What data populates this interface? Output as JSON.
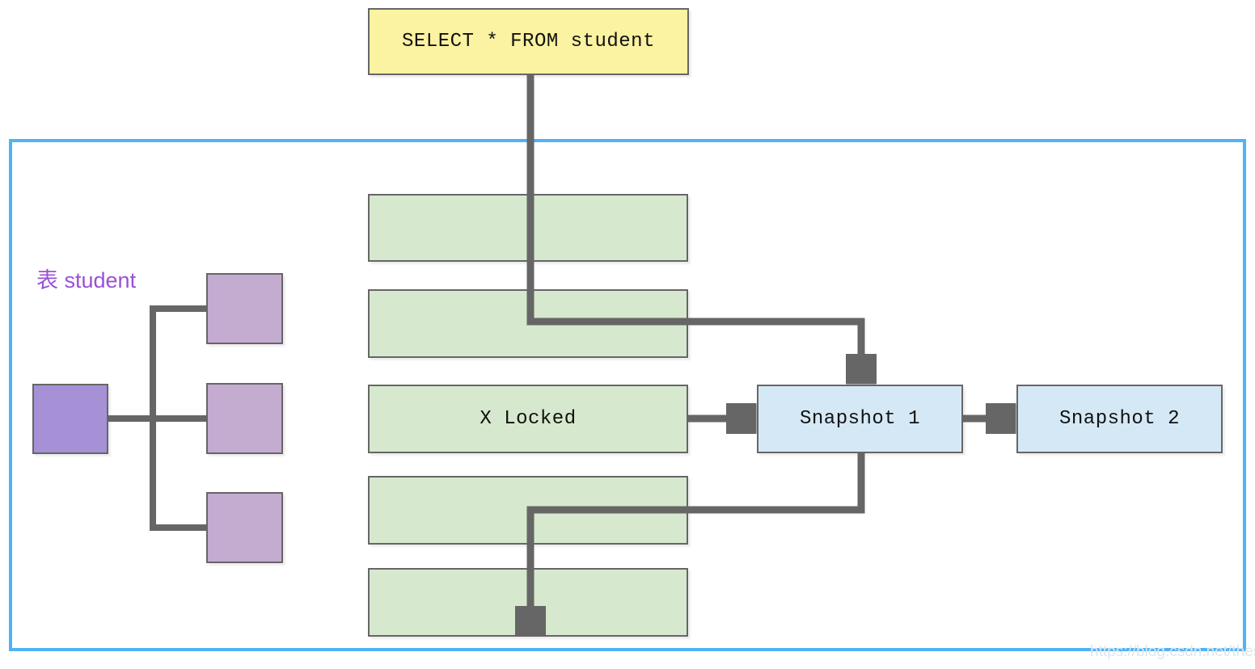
{
  "diagram": {
    "title_query": "SELECT * FROM student",
    "table_label": "表 student",
    "watermark": "https://blog.csdn.net/thesprit",
    "colors": {
      "query_fill": "#fbf2a2",
      "row_fill": "#d6e8cd",
      "snapshot_fill": "#d5e8f6",
      "node_stroke": "#666666",
      "frame_border": "#4fb3f6",
      "label_text": "#9b50d6",
      "purple_root": "#a690d6",
      "purple_leaf": "#c4abd0",
      "edge_stroke": "#666666"
    },
    "tree": {
      "root_label": "",
      "leaves": [
        "",
        "",
        ""
      ]
    },
    "rows": [
      {
        "label": ""
      },
      {
        "label": ""
      },
      {
        "label": "X Locked"
      },
      {
        "label": ""
      },
      {
        "label": ""
      }
    ],
    "snapshots": [
      {
        "label": "Snapshot 1"
      },
      {
        "label": "Snapshot 2"
      }
    ]
  }
}
